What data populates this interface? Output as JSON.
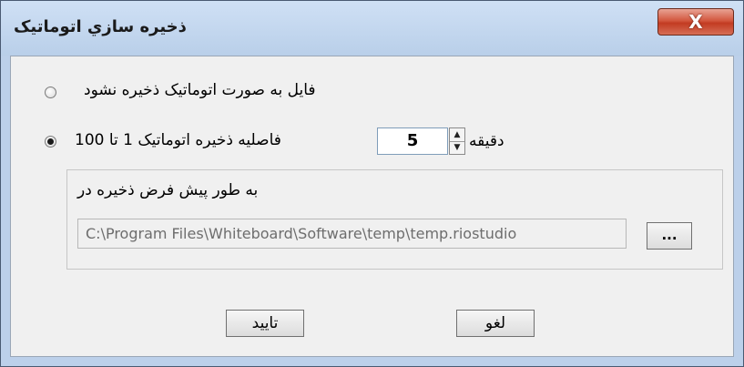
{
  "window": {
    "title": "ذخیره سازي اتوماتیک",
    "close_icon": "close-icon"
  },
  "options": {
    "no_autosave_label": "فایل به صورت اتوماتیک ذخیره نشود",
    "no_autosave_selected": false,
    "interval_label": "فاصلیه ذخیره اتوماتیک 1 تا 100",
    "interval_selected": true
  },
  "interval": {
    "value": "5",
    "unit_label": "دقیقه"
  },
  "default_location": {
    "label": "به طور پیش فرض ذخیره در",
    "path": "C:\\Program Files\\Whiteboard\\Software\\temp\\temp.riostudio",
    "browse_label": "..."
  },
  "buttons": {
    "ok_label": "تایید",
    "cancel_label": "لغو"
  }
}
